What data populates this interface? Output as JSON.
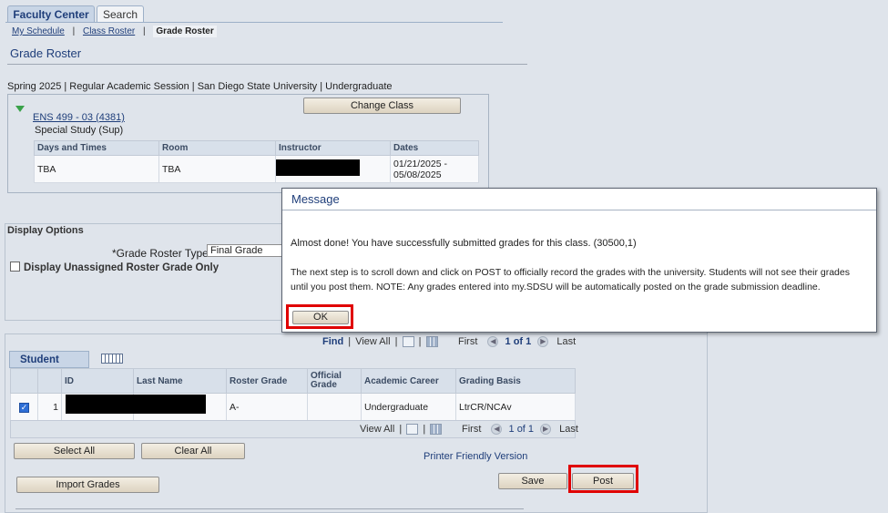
{
  "tabs": [
    {
      "label": "Faculty Center",
      "active": true
    },
    {
      "label": "Search",
      "active": false
    }
  ],
  "breadcrumb": {
    "items": [
      "My Schedule",
      "Class Roster",
      "Grade Roster"
    ],
    "separator": "|"
  },
  "page_title": "Grade Roster",
  "term_line": "Spring 2025 | Regular Academic Session | San Diego State University | Undergraduate",
  "class_info": {
    "link": "ENS 499 - 03 (4381)",
    "description": "Special Study (Sup)",
    "change_class_button": "Change Class",
    "meeting_table": {
      "headers": [
        "Days and Times",
        "Room",
        "Instructor",
        "Dates"
      ],
      "row": {
        "days": "TBA",
        "room": "TBA",
        "instructor": "",
        "dates_start": "01/21/2025 -",
        "dates_end": "05/08/2025"
      }
    }
  },
  "display_options": {
    "heading": "Display Options",
    "roster_type_label": "*Grade Roster Type",
    "roster_type_value": "Final Grade",
    "unassigned_label": "Display Unassigned Roster Grade Only",
    "unassigned_checked": false
  },
  "student_grade": {
    "tab_label": "Student Grade",
    "nav_top": {
      "find": "Find",
      "view_all": "View All",
      "first": "First",
      "range": "1 of 1",
      "last": "Last"
    },
    "headers": [
      "",
      "",
      "ID",
      "Last Name",
      "Roster Grade",
      "Official Grade",
      "Academic Career",
      "Grading Basis"
    ],
    "rows": [
      {
        "checked": true,
        "num": "1",
        "id": "",
        "last_name": "",
        "roster_grade": "A-",
        "official_grade": "",
        "career": "Undergraduate",
        "basis": "LtrCR/NCAv"
      }
    ],
    "nav_bottom": {
      "view_all": "View All",
      "first": "First",
      "range": "1 of 1",
      "last": "Last"
    }
  },
  "actions": {
    "select_all": "Select All",
    "clear_all": "Clear All",
    "printer_friendly": "Printer Friendly Version",
    "import_grades": "Import Grades",
    "save": "Save",
    "post": "Post"
  },
  "modal": {
    "title": "Message",
    "line1": "Almost done! You have successfully submitted grades for this class. (30500,1)",
    "line2": "The next step is to scroll down and click on POST to officially record the grades with the university. Students will not see their grades",
    "line3": "until you post them. NOTE: Any grades entered into my.SDSU will be automatically posted on the grade submission deadline.",
    "ok_button": "OK"
  },
  "colors": {
    "highlight": "#e00000",
    "link": "#1f3e7a",
    "background": "#dfe4eb"
  }
}
